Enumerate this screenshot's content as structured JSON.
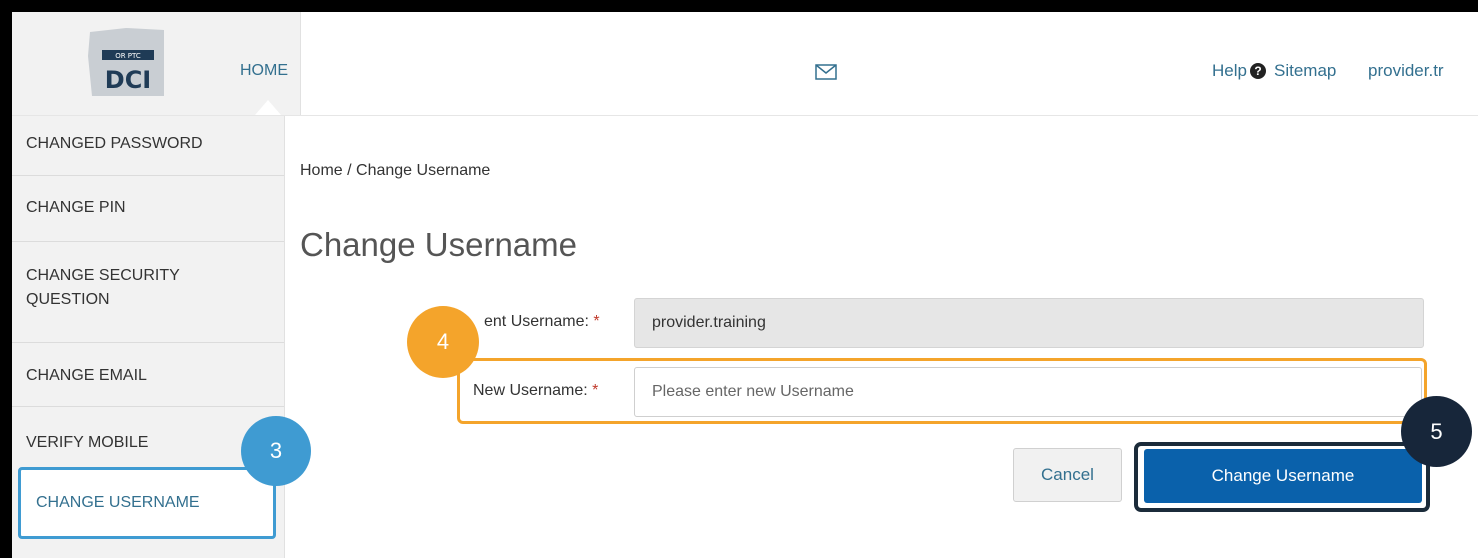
{
  "header": {
    "home_tab": "HOME",
    "help_label": "Help",
    "help_icon": "question-circle-icon",
    "sitemap_label": "Sitemap",
    "user_label": "provider.tr",
    "mail_icon": "envelope-icon"
  },
  "logo": {
    "top_text": "OR PTC",
    "main_text": "DCI"
  },
  "sidebar": {
    "items": [
      {
        "label": "CHANGED PASSWORD"
      },
      {
        "label": "CHANGE PIN"
      },
      {
        "label_line1": "CHANGE SECURITY",
        "label_line2": "QUESTION"
      },
      {
        "label": "CHANGE EMAIL"
      },
      {
        "label": "VERIFY MOBILE"
      },
      {
        "label": "CHANGE USERNAME",
        "active": true
      }
    ]
  },
  "main": {
    "breadcrumb": "Home / Change Username",
    "title": "Change Username",
    "current_label": "ent Username:",
    "current_value": "provider.training",
    "new_label": "New Username:",
    "required_mark": "*",
    "new_placeholder": "Please enter new Username",
    "cancel_label": "Cancel",
    "submit_label": "Change Username"
  },
  "callouts": {
    "step3": "3",
    "step4": "4",
    "step5": "5"
  },
  "colors": {
    "link": "#33708f",
    "primary_button": "#0a61ab",
    "callout_blue": "#3f9bd2",
    "callout_orange": "#f4a42b",
    "callout_navy": "#17263a",
    "required": "#c0392b"
  }
}
